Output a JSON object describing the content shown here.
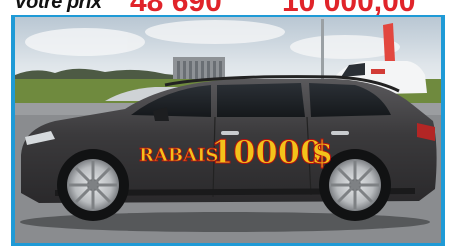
{
  "price_banner": {
    "label": "Votre prix",
    "old_price": "48 690",
    "new_price": "10 000,00"
  },
  "decal": {
    "word": "RABAIS",
    "amount": "10000",
    "currency": "$",
    "color": "#f2c21b",
    "outline": "#b5120f"
  },
  "colors": {
    "accent": "#e0242a",
    "frame": "#1f9ad6",
    "car_body": "#3b3a3c"
  }
}
